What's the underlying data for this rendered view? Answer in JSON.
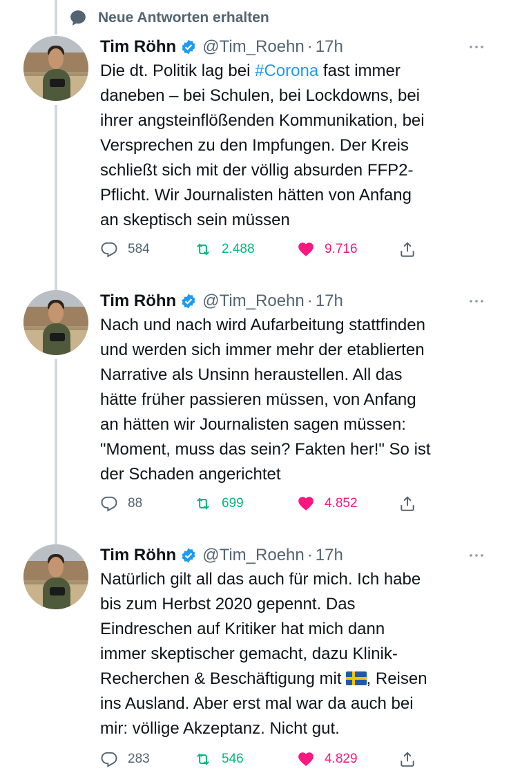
{
  "header": {
    "text": "Neue Antworten erhalten",
    "icon": "speech-bubble-icon"
  },
  "colors": {
    "accent": "#1d9bf0",
    "retweet": "#00ba7c",
    "like": "#f91880",
    "muted": "#536471",
    "thread_line": "#cfd9de"
  },
  "tweets": [
    {
      "author": "Tim Röhn",
      "handle": "@Tim_Roehn",
      "separator": "·",
      "time": "17h",
      "text_before": "Die dt. Politik lag bei ",
      "hashtag": "#Corona",
      "text_after": " fast immer\ndaneben – bei  Schulen, bei Lockdowns, bei\nihrer angsteinflößenden Kommunikation, bei\nVersprechen zu den Impfungen. Der Kreis\nschließt sich mit der völlig absurden FFP2-\nPflicht. Wir Journalisten hätten von Anfang\nan skeptisch sein müssen",
      "replies": "584",
      "retweets": "2.488",
      "likes": "9.716"
    },
    {
      "author": "Tim Röhn",
      "handle": "@Tim_Roehn",
      "separator": "·",
      "time": "17h",
      "text": "Nach und nach wird Aufarbeitung stattfinden\nund werden sich immer mehr der etablierten\nNarrative als Unsinn heraustellen. All das\nhätte früher passieren müssen, von Anfang\nan hätten wir Journalisten sagen müssen:\n\"Moment, muss das sein? Fakten her!\" So ist\nder Schaden angerichtet",
      "replies": "88",
      "retweets": "699",
      "likes": "4.852"
    },
    {
      "author": "Tim Röhn",
      "handle": "@Tim_Roehn",
      "separator": "·",
      "time": "17h",
      "text_before": "Natürlich gilt all das auch für mich. Ich habe\nbis zum Herbst 2020 gepennt. Das\nEindreschen auf Kritiker hat mich dann\nimmer skeptischer gemacht, dazu Klinik-\nRecherchen & Beschäftigung mit",
      "emoji": "sweden-flag-icon",
      "text_after": ", Reisen\nins Ausland. Aber erst mal war da auch bei\nmir: völlige Akzeptanz. Nicht gut.",
      "replies": "283",
      "retweets": "546",
      "likes": "4.829"
    }
  ]
}
